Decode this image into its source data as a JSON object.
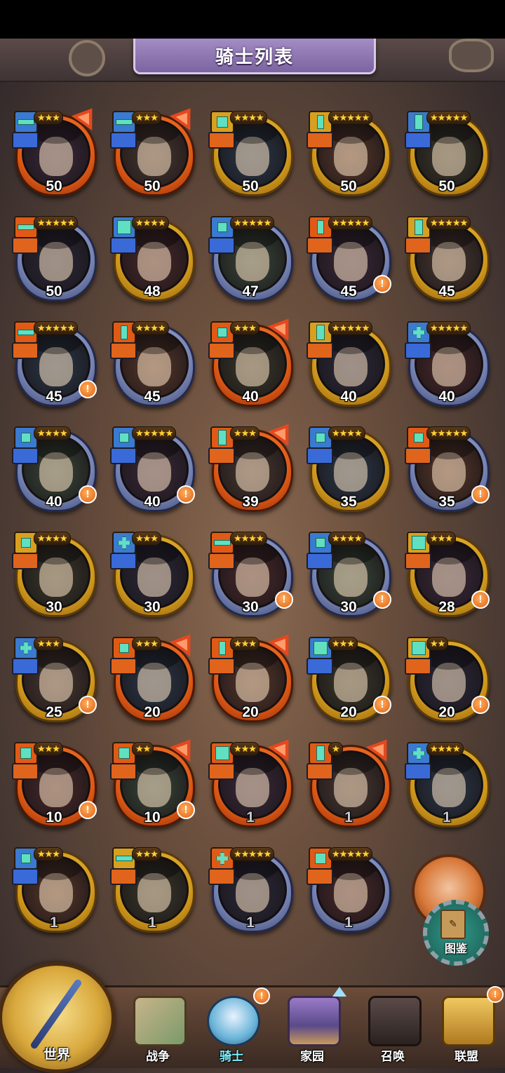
{
  "title": "骑士列表",
  "colors": {
    "gold": "#d29a1c",
    "silver": "#7684b4",
    "orange": "#e05a16",
    "alert": "#e06010"
  },
  "heroes": [
    {
      "level": "50",
      "stars": "★★★",
      "frame": "orange",
      "role": "2h",
      "cls": "blue",
      "rankup": true,
      "alert": false
    },
    {
      "level": "50",
      "stars": "★★★",
      "frame": "orange",
      "role": "2h",
      "cls": "blue",
      "rankup": true,
      "alert": false
    },
    {
      "level": "50",
      "stars": "★★★★",
      "frame": "gold",
      "role": "x3",
      "cls": "orange",
      "rankup": false,
      "alert": false
    },
    {
      "level": "50",
      "stars": "★★★★★",
      "frame": "gold",
      "role": "v1",
      "cls": "orange",
      "rankup": false,
      "alert": false
    },
    {
      "level": "50",
      "stars": "★★★★★",
      "frame": "gold",
      "role": "v2",
      "cls": "blue",
      "rankup": false,
      "alert": false
    },
    {
      "level": "50",
      "stars": "★★★★★",
      "frame": "silver",
      "role": "2h",
      "cls": "orange",
      "rankup": false,
      "alert": false
    },
    {
      "level": "48",
      "stars": "★★★★",
      "frame": "gold",
      "role": "grid",
      "cls": "blue",
      "rankup": false,
      "alert": false
    },
    {
      "level": "47",
      "stars": "★★★★★",
      "frame": "silver",
      "role": "sq",
      "cls": "blue",
      "rankup": false,
      "alert": false
    },
    {
      "level": "45",
      "stars": "★★★★★",
      "frame": "silver",
      "role": "v1",
      "cls": "orange",
      "rankup": false,
      "alert": true
    },
    {
      "level": "45",
      "stars": "★★★★★",
      "frame": "gold",
      "role": "v2",
      "cls": "orange",
      "rankup": false,
      "alert": false
    },
    {
      "level": "45",
      "stars": "★★★★★",
      "frame": "silver",
      "role": "2h",
      "cls": "orange",
      "rankup": false,
      "alert": true
    },
    {
      "level": "45",
      "stars": "★★★★",
      "frame": "silver",
      "role": "v1",
      "cls": "orange",
      "rankup": false,
      "alert": false
    },
    {
      "level": "40",
      "stars": "★★★",
      "frame": "orange",
      "role": "sq",
      "cls": "orange",
      "rankup": true,
      "alert": false
    },
    {
      "level": "40",
      "stars": "★★★★★",
      "frame": "gold",
      "role": "v2",
      "cls": "orange",
      "rankup": false,
      "alert": false
    },
    {
      "level": "40",
      "stars": "★★★★★",
      "frame": "silver",
      "role": "plus",
      "cls": "blue",
      "rankup": false,
      "alert": false
    },
    {
      "level": "40",
      "stars": "★★★★",
      "frame": "silver",
      "role": "sq",
      "cls": "blue",
      "rankup": false,
      "alert": true
    },
    {
      "level": "40",
      "stars": "★★★★★",
      "frame": "silver",
      "role": "sq",
      "cls": "blue",
      "rankup": false,
      "alert": true
    },
    {
      "level": "39",
      "stars": "★★★",
      "frame": "orange",
      "role": "v2",
      "cls": "orange",
      "rankup": true,
      "alert": false
    },
    {
      "level": "35",
      "stars": "★★★★",
      "frame": "gold",
      "role": "sq",
      "cls": "blue",
      "rankup": false,
      "alert": false
    },
    {
      "level": "35",
      "stars": "★★★★★",
      "frame": "silver",
      "role": "sq",
      "cls": "orange",
      "rankup": false,
      "alert": true
    },
    {
      "level": "30",
      "stars": "★★★★",
      "frame": "gold",
      "role": "sq",
      "cls": "orange",
      "rankup": false,
      "alert": false
    },
    {
      "level": "30",
      "stars": "★★★",
      "frame": "gold",
      "role": "plus",
      "cls": "blue",
      "rankup": false,
      "alert": false
    },
    {
      "level": "30",
      "stars": "★★★★",
      "frame": "silver",
      "role": "2h",
      "cls": "orange",
      "rankup": false,
      "alert": true
    },
    {
      "level": "30",
      "stars": "★★★★",
      "frame": "silver",
      "role": "sq",
      "cls": "blue",
      "rankup": false,
      "alert": true
    },
    {
      "level": "28",
      "stars": "★★★",
      "frame": "gold",
      "role": "grid",
      "cls": "orange",
      "rankup": false,
      "alert": true
    },
    {
      "level": "25",
      "stars": "★★★",
      "frame": "gold",
      "role": "plus",
      "cls": "blue",
      "rankup": false,
      "alert": true
    },
    {
      "level": "20",
      "stars": "★★★",
      "frame": "orange",
      "role": "sq",
      "cls": "orange",
      "rankup": true,
      "alert": false
    },
    {
      "level": "20",
      "stars": "★★★",
      "frame": "orange",
      "role": "v1",
      "cls": "orange",
      "rankup": true,
      "alert": false
    },
    {
      "level": "20",
      "stars": "★★★",
      "frame": "gold",
      "role": "grid",
      "cls": "blue",
      "rankup": false,
      "alert": true
    },
    {
      "level": "20",
      "stars": "★★",
      "frame": "gold",
      "role": "grid",
      "cls": "orange",
      "rankup": false,
      "alert": true
    },
    {
      "level": "10",
      "stars": "★★★",
      "frame": "orange",
      "role": "x2",
      "cls": "orange",
      "rankup": false,
      "alert": true
    },
    {
      "level": "10",
      "stars": "★★",
      "frame": "orange",
      "role": "x3",
      "cls": "orange",
      "rankup": true,
      "alert": true
    },
    {
      "level": "1",
      "stars": "★★★",
      "frame": "orange",
      "role": "grid",
      "cls": "orange",
      "rankup": true,
      "alert": false
    },
    {
      "level": "1",
      "stars": "★",
      "frame": "orange",
      "role": "v2",
      "cls": "orange",
      "rankup": true,
      "alert": false
    },
    {
      "level": "1",
      "stars": "★★★★",
      "frame": "gold",
      "role": "plus",
      "cls": "blue",
      "rankup": false,
      "alert": false
    },
    {
      "level": "1",
      "stars": "★★★",
      "frame": "gold",
      "role": "sq",
      "cls": "blue",
      "rankup": false,
      "alert": false
    },
    {
      "level": "1",
      "stars": "★★★",
      "frame": "gold",
      "role": "2h",
      "cls": "orange",
      "rankup": false,
      "alert": false
    },
    {
      "level": "1",
      "stars": "★★★★★",
      "frame": "silver",
      "role": "plus",
      "cls": "orange",
      "rankup": false,
      "alert": false
    },
    {
      "level": "1",
      "stars": "★★★★★",
      "frame": "silver",
      "role": "x3",
      "cls": "orange",
      "rankup": false,
      "alert": false
    }
  ],
  "collection_label": "图鉴",
  "book_glyph": "✎",
  "alert_glyph": "!",
  "nav": {
    "world": "世界",
    "war": "战争",
    "knight": "骑士",
    "home": "家园",
    "summon": "召唤",
    "alliance": "联盟"
  }
}
